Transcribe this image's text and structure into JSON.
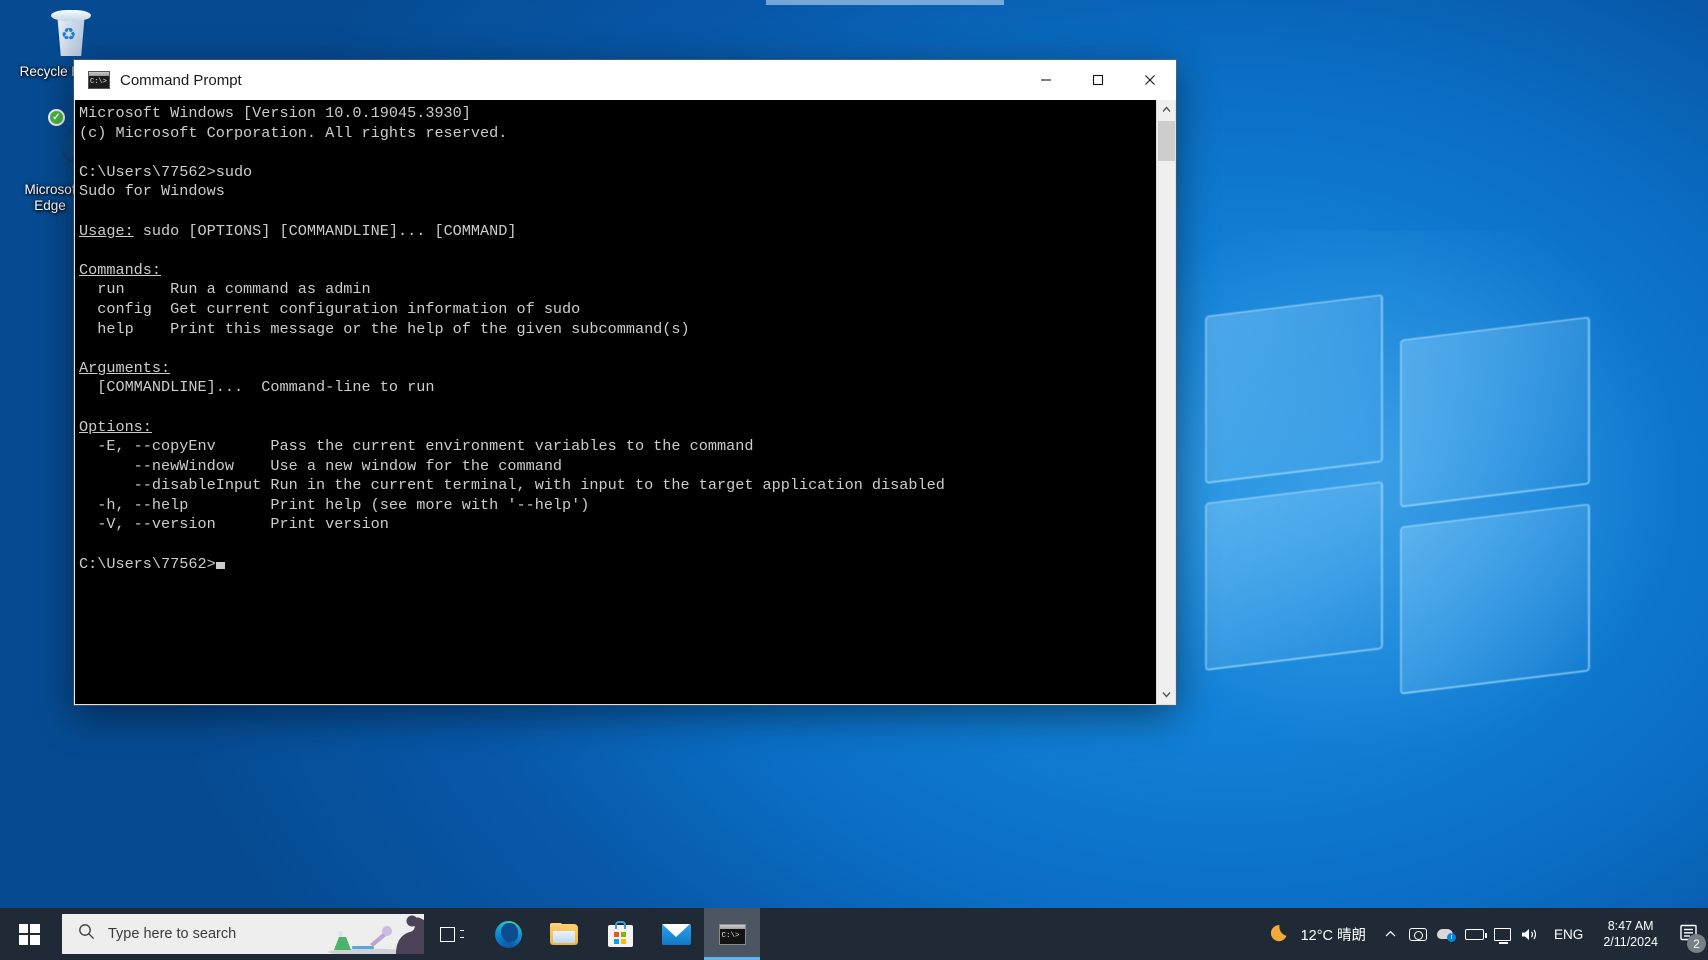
{
  "desktop": {
    "icons": [
      {
        "name": "recycle-bin",
        "label": "Recycle B"
      },
      {
        "name": "microsoft-edge",
        "label": "Microsof\nEdge"
      }
    ]
  },
  "window": {
    "title": "Command Prompt",
    "icon": "cmd-icon",
    "controls": {
      "minimize": "─",
      "maximize": "☐",
      "close": "✕"
    },
    "console": {
      "lines": [
        "Microsoft Windows [Version 10.0.19045.3930]",
        "(c) Microsoft Corporation. All rights reserved.",
        "",
        "C:\\Users\\77562>sudo",
        "Sudo for Windows",
        "",
        "Usage: sudo [OPTIONS] [COMMANDLINE]... [COMMAND]",
        "",
        "Commands:",
        "  run     Run a command as admin",
        "  config  Get current configuration information of sudo",
        "  help    Print this message or the help of the given subcommand(s)",
        "",
        "Arguments:",
        "  [COMMANDLINE]...  Command-line to run",
        "",
        "Options:",
        "  -E, --copyEnv      Pass the current environment variables to the command",
        "      --newWindow    Use a new window for the command",
        "      --disableInput Run in the current terminal, with input to the target application disabled",
        "  -h, --help         Print help (see more with '--help')",
        "  -V, --version      Print version",
        "",
        "C:\\Users\\77562>"
      ],
      "underlined_headings": [
        "Usage:",
        "Commands:",
        "Arguments:",
        "Options:"
      ],
      "prompt": "C:\\Users\\77562>",
      "cursor": "block"
    },
    "scrollbar": {
      "up_arrow": "⌃",
      "down_arrow": "⌄"
    }
  },
  "taskbar": {
    "start": "start-button",
    "search": {
      "placeholder": "Type here to search",
      "icon": "search-icon"
    },
    "buttons": [
      {
        "name": "task-view",
        "label": "Task View"
      },
      {
        "name": "microsoft-edge",
        "label": "Microsoft Edge"
      },
      {
        "name": "file-explorer",
        "label": "File Explorer"
      },
      {
        "name": "microsoft-store",
        "label": "Microsoft Store"
      },
      {
        "name": "mail",
        "label": "Mail"
      },
      {
        "name": "command-prompt",
        "label": "Command Prompt",
        "active": true
      }
    ],
    "tray": {
      "weather": {
        "icon": "moon-icon",
        "temperature": "12°C",
        "condition": "晴朗"
      },
      "show_hidden": "⌃",
      "icons": [
        "camera-icon",
        "network-cloud-icon",
        "battery-icon",
        "display-icon",
        "volume-icon"
      ],
      "language": "ENG",
      "clock": {
        "time": "8:47 AM",
        "date": "2/11/2024"
      },
      "notifications": {
        "icon": "notification-icon",
        "count": "2"
      }
    }
  },
  "colors": {
    "accent": "#0a6ec4",
    "taskbar": "#1f2a36",
    "console_bg": "#000000",
    "console_fg": "#cccccc",
    "active_tab_underline": "#5fb2f0"
  }
}
